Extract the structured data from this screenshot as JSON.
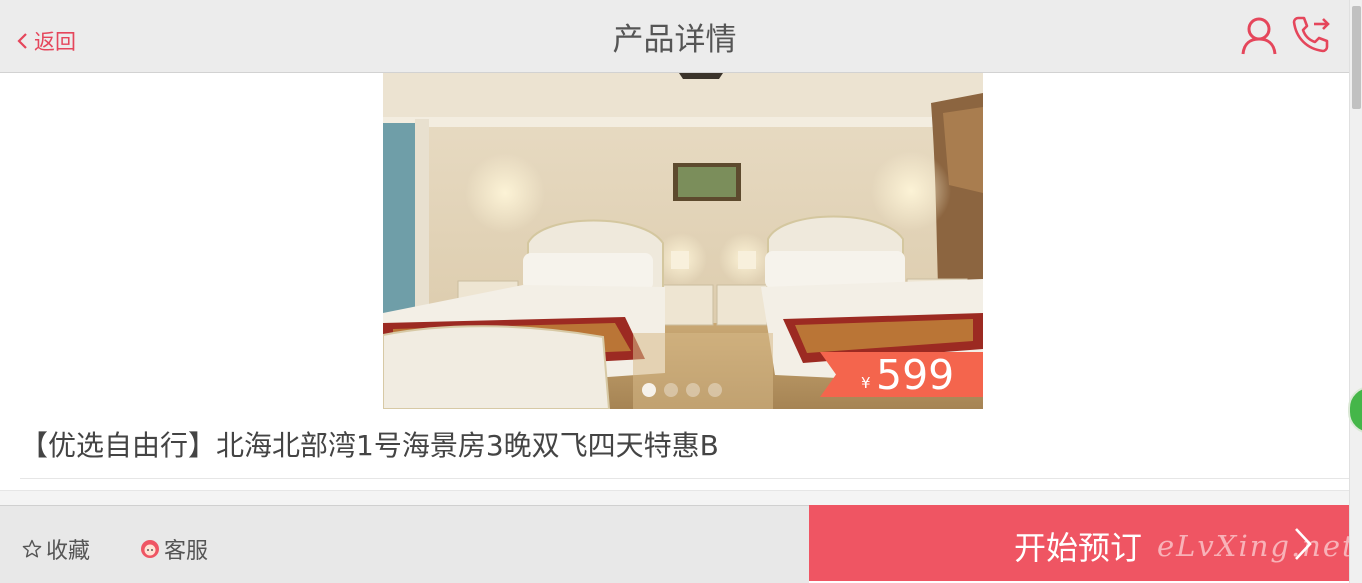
{
  "header": {
    "back_label": "返回",
    "title": "产品详情",
    "icons": [
      "user-icon",
      "phone-icon"
    ]
  },
  "hero": {
    "price_currency": "¥",
    "price_value": "599",
    "carousel_dots": 4,
    "active_dot": 0
  },
  "product": {
    "title": "【优选自由行】北海北部湾1号海景房3晚双飞四天特惠B"
  },
  "bottom": {
    "favorite_label": "收藏",
    "service_label": "客服",
    "book_label": "开始预订",
    "watermark": "eLvXing.net"
  },
  "colors": {
    "accent": "#e5465b",
    "book_button": "#ef5563",
    "price_tag": "#f4654d",
    "header_bg": "#ececec"
  }
}
